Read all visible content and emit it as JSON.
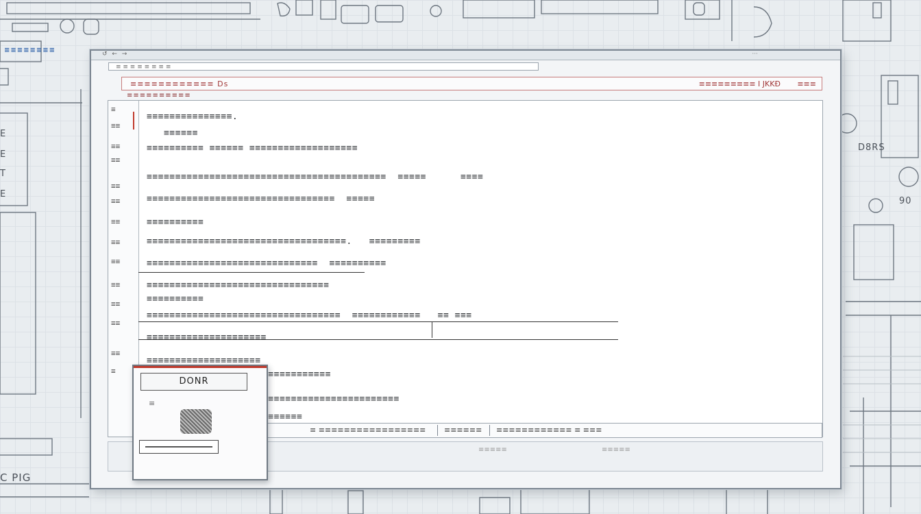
{
  "window": {
    "titlebar": "↺ ← →",
    "titlebar_right": "···",
    "address": "≡ ≡ ≡ ≡ ≡ ≡ ≡ ≡",
    "header_left": "≡≡≡≡≡≡≡≡≡≡≡≡  Ds",
    "header_right": "≡≡≡≡≡≡≡≡≡  I  JKKÐ",
    "header_far": "≡≡≡",
    "subheader": "≡≡≡≡≡≡≡≡≡≡"
  },
  "editor": {
    "gutter_marks": [
      "≡",
      "≡≡",
      "≡≡",
      "≡≡",
      "≡≡",
      "≡≡",
      "≡≡",
      "≡≡",
      "≡≡",
      "≡≡",
      "≡≡",
      "≡≡",
      "≡≡",
      "≡"
    ],
    "lines": [
      "≡≡≡≡≡≡≡≡≡≡≡≡≡≡≡.",
      "   ≡≡≡≡≡≡",
      "≡≡≡≡≡≡≡≡≡≡ ≡≡≡≡≡≡ ≡≡≡≡≡≡≡≡≡≡≡≡≡≡≡≡≡≡≡",
      "≡≡≡≡≡≡≡≡≡≡≡≡≡≡≡≡≡≡≡≡≡≡≡≡≡≡≡≡≡≡≡≡≡≡≡≡≡≡≡≡≡≡  ≡≡≡≡≡      ≡≡≡≡",
      "≡≡≡≡≡≡≡≡≡≡≡≡≡≡≡≡≡≡≡≡≡≡≡≡≡≡≡≡≡≡≡≡≡  ≡≡≡≡≡",
      "≡≡≡≡≡≡≡≡≡≡",
      "≡≡≡≡≡≡≡≡≡≡≡≡≡≡≡≡≡≡≡≡≡≡≡≡≡≡≡≡≡≡≡≡≡≡≡.   ≡≡≡≡≡≡≡≡≡",
      "≡≡≡≡≡≡≡≡≡≡≡≡≡≡≡≡≡≡≡≡≡≡≡≡≡≡≡≡≡≡  ≡≡≡≡≡≡≡≡≡≡",
      "≡≡≡≡≡≡≡≡≡≡≡≡≡≡≡≡≡≡≡≡≡≡≡≡≡≡≡≡≡≡≡≡",
      "≡≡≡≡≡≡≡≡≡≡",
      "≡≡≡≡≡≡≡≡≡≡≡≡≡≡≡≡≡≡≡≡≡≡≡≡≡≡≡≡≡≡≡≡≡≡  ≡≡≡≡≡≡≡≡≡≡≡≡   ≡≡ ≡≡≡",
      "≡≡≡≡≡≡≡≡≡≡≡≡≡≡≡≡≡≡≡≡≡",
      "≡≡≡≡≡≡≡≡≡≡≡≡≡≡≡≡≡≡≡≡",
      "≡≡≡≡≡≡≡≡≡≡≡≡≡≡≡",
      "≡≡≡≡≡≡≡≡≡≡≡≡≡≡≡≡≡≡≡≡≡≡≡≡≡≡≡",
      "≡≡≡≡≡≡≡≡≡≡"
    ]
  },
  "statusbar": {
    "seg1": "≡  ≡≡≡≡≡≡≡≡≡≡≡≡≡≡≡≡≡",
    "seg2": "≡≡≡≡≡≡",
    "seg3": "≡≡≡≡≡≡≡≡≡≡≡≡ ≡ ≡≡≡"
  },
  "footer": {
    "left": "≡≡≡≡≡",
    "right": "≡≡≡≡≡"
  },
  "dialog": {
    "button_label": "DONR",
    "scribble": "≡"
  },
  "background": {
    "brand_tag": "≡≡≡≡≡≡≡≡",
    "pins_label": "C PIG",
    "right_code_1": "D8RS",
    "right_code_2": "90",
    "left_letters": [
      "E",
      "E",
      "T",
      "E"
    ]
  },
  "colors": {
    "accent_red": "#c0392b",
    "window_border": "#7d8792",
    "paper": "#ffffff"
  }
}
